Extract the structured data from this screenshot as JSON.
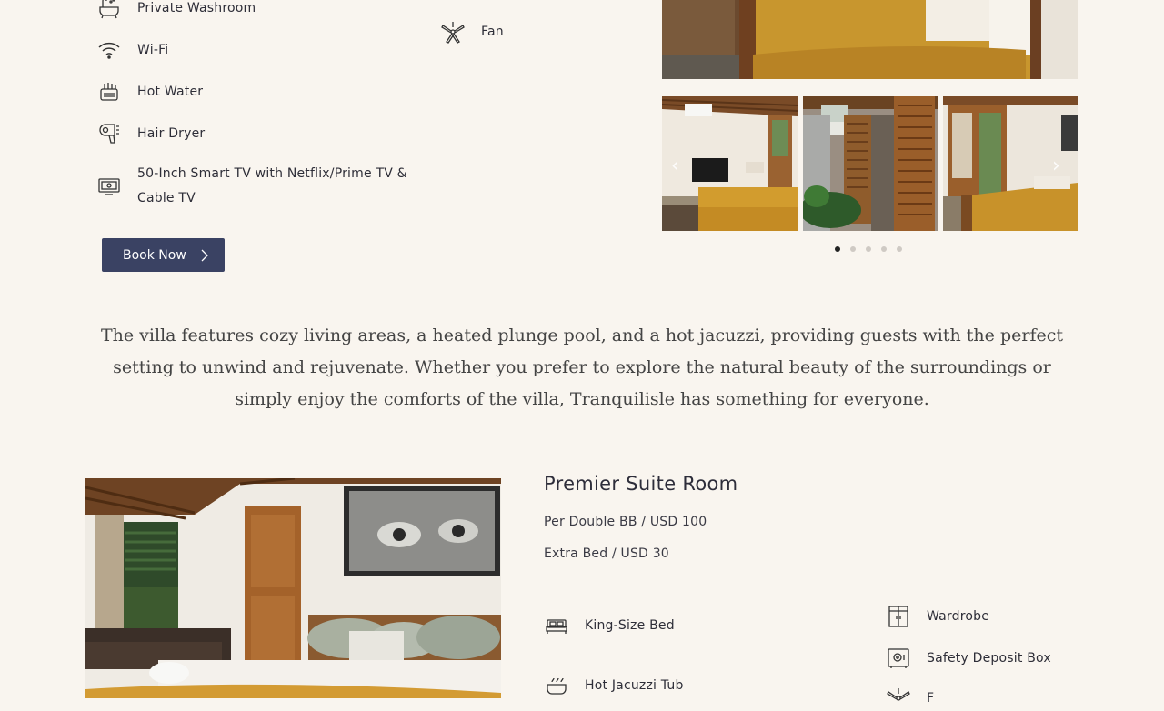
{
  "amenities_left": [
    {
      "icon": "bathtub-icon",
      "label": "Private Washroom"
    },
    {
      "icon": "wifi-icon",
      "label": "Wi-Fi"
    },
    {
      "icon": "water-heater-icon",
      "label": "Hot Water"
    },
    {
      "icon": "hair-dryer-icon",
      "label": "Hair Dryer"
    },
    {
      "icon": "tv-icon",
      "label": "50-Inch Smart TV with Netflix/Prime TV & Cable TV"
    }
  ],
  "amenities_mid": [
    {
      "icon": "fan-icon",
      "label": "Fan"
    }
  ],
  "book_button": {
    "label": "Book Now"
  },
  "gallery": {
    "prev_icon": "chevron-left-icon",
    "next_icon": "chevron-right-icon",
    "dots_count": 5,
    "active_dot": 1
  },
  "description": "The villa features cozy living areas, a heated plunge pool, and a hot jacuzzi, providing guests with the perfect setting to unwind and rejuvenate. Whether you prefer to explore the natural beauty of the surroundings or simply enjoy the comforts of the villa, Tranquilisle has something for everyone.",
  "room": {
    "title": "Premier Suite Room",
    "price_line1": "Per Double BB / USD 100",
    "price_line2": "Extra Bed / USD 30",
    "amenities_left": [
      {
        "icon": "bed-icon",
        "label": "King-Size Bed"
      },
      {
        "icon": "jacuzzi-icon",
        "label": "Hot Jacuzzi Tub"
      }
    ],
    "amenities_right": [
      {
        "icon": "wardrobe-icon",
        "label": "Wardrobe"
      },
      {
        "icon": "safe-icon",
        "label": "Safety Deposit Box"
      },
      {
        "icon": "fan-icon",
        "label": "F"
      }
    ]
  },
  "colors": {
    "background": "#f9f5ef",
    "button": "#3a4263",
    "text": "#2d2d3a"
  }
}
